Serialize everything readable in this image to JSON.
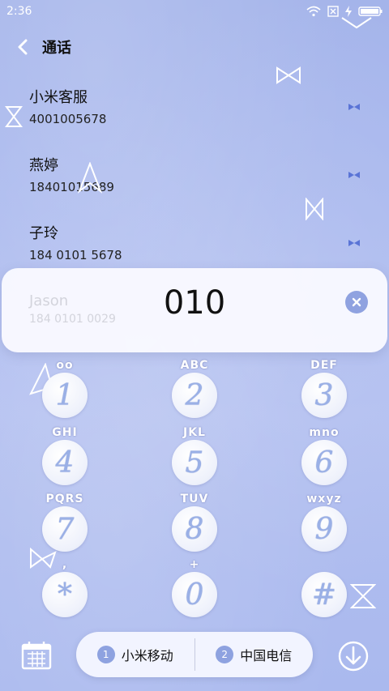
{
  "status": {
    "time": "2:36"
  },
  "header": {
    "title": "通话"
  },
  "contacts": [
    {
      "name": "小米客服",
      "number": "4001005678"
    },
    {
      "name": "燕婷",
      "number": "18401015689"
    },
    {
      "name": "子玲",
      "number": "184 0101 5678"
    }
  ],
  "suggestion": {
    "name": "Jason",
    "number": "184 0101 0029"
  },
  "dialed_number": "010",
  "keypad": [
    {
      "digit": "1",
      "letters": "oo"
    },
    {
      "digit": "2",
      "letters": "ABC"
    },
    {
      "digit": "3",
      "letters": "DEF"
    },
    {
      "digit": "4",
      "letters": "GHI"
    },
    {
      "digit": "5",
      "letters": "JKL"
    },
    {
      "digit": "6",
      "letters": "mno"
    },
    {
      "digit": "7",
      "letters": "PQRS"
    },
    {
      "digit": "8",
      "letters": "TUV"
    },
    {
      "digit": "9",
      "letters": "wxyz"
    },
    {
      "digit": "*",
      "letters": ","
    },
    {
      "digit": "0",
      "letters": "+"
    },
    {
      "digit": "#",
      "letters": ""
    }
  ],
  "sim": {
    "sim1_label": "小米移动",
    "sim2_label": "中国电信",
    "sim1_num": "1",
    "sim2_num": "2"
  },
  "colors": {
    "accent": "#8ea2e0",
    "background": "#a9b8ee"
  }
}
